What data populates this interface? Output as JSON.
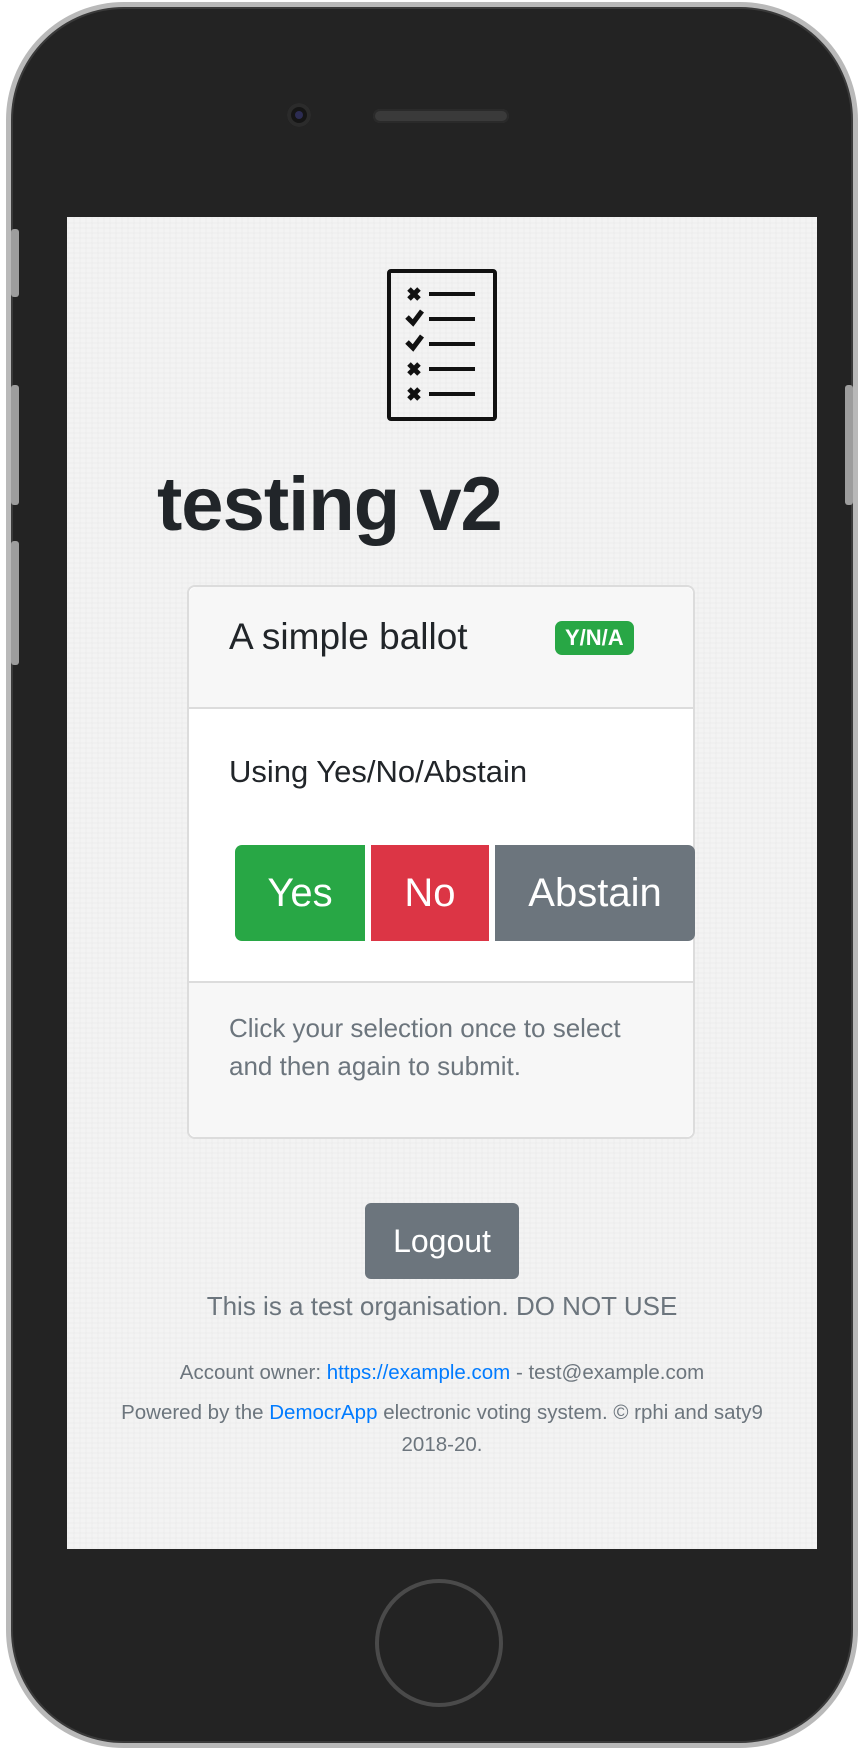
{
  "page": {
    "organisation_title": "testing v2"
  },
  "ballot": {
    "title": "A simple ballot",
    "type_badge": "Y/N/A",
    "question": "Using Yes/No/Abstain",
    "options": [
      "Yes",
      "No",
      "Abstain"
    ],
    "instructions": "Click your selection once to select and then again to submit."
  },
  "actions": {
    "logout_label": "Logout"
  },
  "footer": {
    "org_note": "This is a test organisation. DO NOT USE",
    "owner_prefix": "Account owner:",
    "owner_url": "https://example.com",
    "owner_separator": "-",
    "owner_email": "test@example.com",
    "powered_prefix": "Powered by the",
    "app_name": "DemocrApp",
    "powered_suffix": "electronic voting system. © rphi and saty9 2018-20."
  },
  "icons": {
    "ballot": "ballot-checklist-icon",
    "camera": "front-camera-icon",
    "home": "home-button"
  },
  "colors": {
    "yes": "#28a745",
    "no": "#dc3545",
    "abstain": "#6c757d",
    "badge": "#28a745",
    "link": "#007bff",
    "text": "#212529",
    "muted": "#6c757d"
  }
}
